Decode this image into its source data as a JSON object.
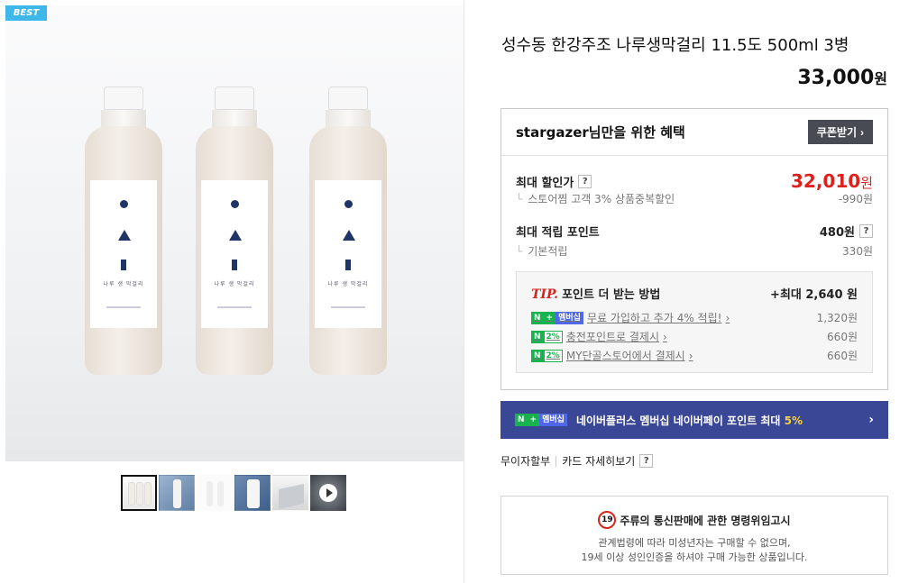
{
  "badge": "BEST",
  "product": {
    "title": "성수동 한강주조 나루생막걸리 11.5도 500ml 3병",
    "price": "33,000",
    "currency": "원",
    "bottle_label": "나루 생 막걸리"
  },
  "benefit": {
    "title": "stargazer님만을 위한 혜택",
    "coupon_button": "쿠폰받기",
    "max_discount_label": "최대 할인가",
    "max_discount_value": "32,010",
    "discount_sub_label": "스토어찜 고객 3% 상품중복할인",
    "discount_sub_value": "-990원",
    "max_point_label": "최대 적립 포인트",
    "max_point_value": "480원",
    "base_point_label": "기본적립",
    "base_point_value": "330원",
    "help": "?"
  },
  "tip": {
    "tip_label": "TIP.",
    "title": "포인트 더 받는 방법",
    "max": "+최대 2,640 원",
    "rows": [
      {
        "badge_n": "N",
        "badge_extra": "+",
        "badge_member": "멤버십",
        "text": "무료 가입하고 추가 4% 적립!",
        "value": "1,320원"
      },
      {
        "badge_n": "N",
        "badge_extra": "2%",
        "text": "충전포인트로 결제시",
        "value": "660원"
      },
      {
        "badge_n": "N",
        "badge_extra": "2%",
        "text": "MY단골스토어에서 결제시",
        "value": "660원"
      }
    ]
  },
  "banner": {
    "badge_n": "N",
    "badge_plus": "+",
    "badge_member": "멤버십",
    "text": "네이버플러스 멤버십 네이버페이 포인트 최대",
    "highlight": "5%"
  },
  "links": {
    "installment": "무이자할부",
    "card_detail": "카드 자세히보기",
    "help": "?"
  },
  "notice": {
    "age_mark": "19",
    "title": "주류의 통신판매에 관한 명령위임고시",
    "line1": "관계법령에 따라 미성년자는 구매할 수 없으며,",
    "line2": "19세 이상 성인인증을 하셔야 구매 가능한 상품입니다."
  },
  "colors": {
    "accent_red": "#e0201c",
    "banner_bg": "#3a4796",
    "naver_green": "#18b34f",
    "best_badge": "#3fb7e8"
  }
}
